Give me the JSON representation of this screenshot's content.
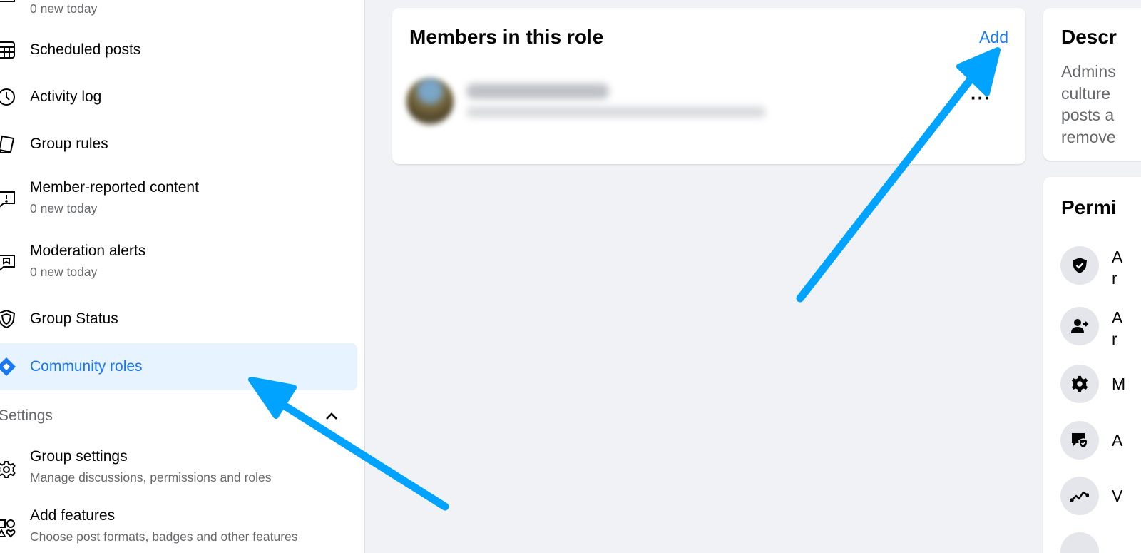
{
  "sidebar": {
    "items": [
      {
        "label": "",
        "sub": "0 new today"
      },
      {
        "label": "Scheduled posts"
      },
      {
        "label": "Activity log"
      },
      {
        "label": "Group rules"
      },
      {
        "label": "Member-reported content",
        "sub": "0 new today"
      },
      {
        "label": "Moderation alerts",
        "sub": "0 new today"
      },
      {
        "label": "Group Status"
      },
      {
        "label": "Community roles",
        "active": true
      },
      {
        "label": "Group settings",
        "sub": "Manage discussions, permissions and roles"
      },
      {
        "label": "Add features",
        "sub": "Choose post formats, badges and other features"
      }
    ],
    "section_settings": "Settings"
  },
  "members": {
    "title": "Members in this role",
    "add_label": "Add",
    "more_label": "···"
  },
  "description": {
    "title": "Descr",
    "text_lines": [
      "Admins",
      "culture",
      "posts a",
      "remove"
    ]
  },
  "permissions": {
    "title": "Permi",
    "items": [
      {
        "icon": "shield-check-icon",
        "line1": "A",
        "line2": "r"
      },
      {
        "icon": "person-arrow-icon",
        "line1": "A",
        "line2": "r"
      },
      {
        "icon": "gear-icon",
        "line1": "M"
      },
      {
        "icon": "chat-shield-icon",
        "line1": "A"
      },
      {
        "icon": "trend-line-icon",
        "line1": "V"
      }
    ]
  },
  "colors": {
    "accent": "#1877f2",
    "arrow": "#00a3ff",
    "active_bg": "#e7f3ff"
  }
}
